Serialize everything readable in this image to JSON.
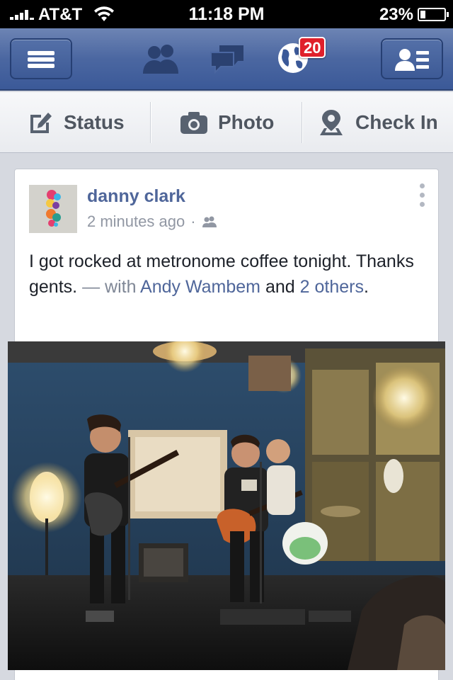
{
  "status_bar": {
    "carrier": "AT&T",
    "time": "11:18 PM",
    "battery": "23%",
    "battery_level": 0.23
  },
  "nav": {
    "menu_icon": "hamburger-icon",
    "friend_requests_icon": "friends-icon",
    "messages_icon": "messages-icon",
    "notifications_icon": "globe-icon",
    "notifications_badge": "20",
    "right_icon": "contacts-list-icon"
  },
  "publisher": {
    "status_label": "Status",
    "photo_label": "Photo",
    "checkin_label": "Check In"
  },
  "post": {
    "author": "danny clark",
    "time": "2 minutes ago",
    "separator": "·",
    "audience_icon": "friends-audience-icon",
    "text": "I got rocked at metronome coffee tonight. Thanks gents.",
    "with_prefix": "— with",
    "tagged_name": "Andy Wambem",
    "and_word": "and",
    "others_link": "2 others",
    "end_punct": "."
  },
  "colors": {
    "facebook_blue": "#3b5998",
    "link": "#4f669a",
    "badge_red": "#e0202b"
  }
}
